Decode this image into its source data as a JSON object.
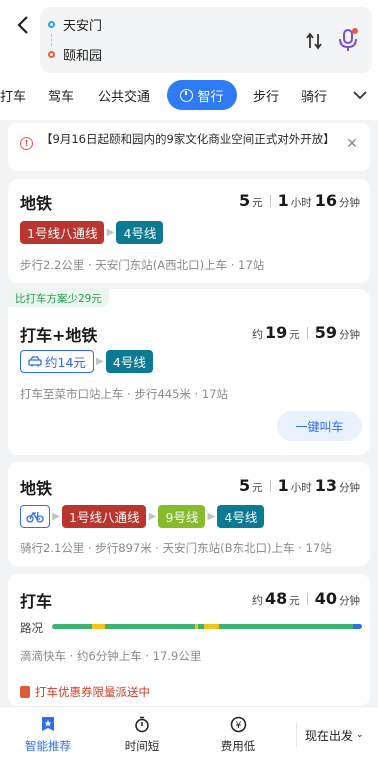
{
  "header": {
    "from": "天安门",
    "to": "颐和园"
  },
  "modes": [
    "打车",
    "驾车",
    "公共交通",
    "智行",
    "步行",
    "骑行"
  ],
  "active_mode": "智行",
  "notice": {
    "text": "【9月16日起颐和园内的9家文化商业空间正式对外开放】"
  },
  "routes": [
    {
      "title": "地铁",
      "price": "5",
      "price_unit": "元",
      "hours": "1",
      "hours_unit": "小时",
      "minutes": "16",
      "minutes_unit": "分钟",
      "lines": [
        "1号线八通线",
        "4号线"
      ],
      "desc": "步行2.2公里 · 天安门东站(A西北口)上车 · 17站"
    },
    {
      "badge": "比打车方案少29元",
      "title": "打车+地铁",
      "price_prefix": "约",
      "price": "19",
      "price_unit": "元",
      "minutes": "59",
      "minutes_unit": "分钟",
      "taxi_fare": "约14元",
      "lines": [
        "4号线"
      ],
      "desc": "打车至菜市口站上车 · 步行445米 · 17站",
      "call_button": "一键叫车"
    },
    {
      "title": "地铁",
      "price": "5",
      "price_unit": "元",
      "hours": "1",
      "hours_unit": "小时",
      "minutes": "13",
      "minutes_unit": "分钟",
      "lines": [
        "1号线八通线",
        "9号线",
        "4号线"
      ],
      "desc": "骑行2.1公里 · 步行897米 · 天安门东站(B东北口)上车 · 17站"
    },
    {
      "title": "打车",
      "price_prefix": "约",
      "price": "48",
      "price_unit": "元",
      "minutes": "40",
      "minutes_unit": "分钟",
      "traffic_label": "路况",
      "desc": "滴滴快车 · 约6分钟上车 · 17.9公里",
      "coupon": "打车优惠券限量派送中"
    }
  ],
  "traffic_segments": [
    {
      "share": 0.13,
      "color": "#3cb371"
    },
    {
      "share": 0.04,
      "color": "#f0c419"
    },
    {
      "share": 0.29,
      "color": "#3cb371"
    },
    {
      "share": 0.01,
      "color": "#f0c419"
    },
    {
      "share": 0.02,
      "color": "#3cb371"
    },
    {
      "share": 0.05,
      "color": "#f0c419"
    },
    {
      "share": 0.43,
      "color": "#3cb371"
    },
    {
      "share": 0.03,
      "color": "#2f6ee8"
    }
  ],
  "bottom": {
    "tabs": [
      "智能推荐",
      "时间短",
      "费用低"
    ],
    "depart": "现在出发"
  },
  "colors": {
    "accent": "#2f7bf5",
    "line1": "#b9352d",
    "line4": "#0c7a93",
    "line9": "#86bb2a"
  }
}
